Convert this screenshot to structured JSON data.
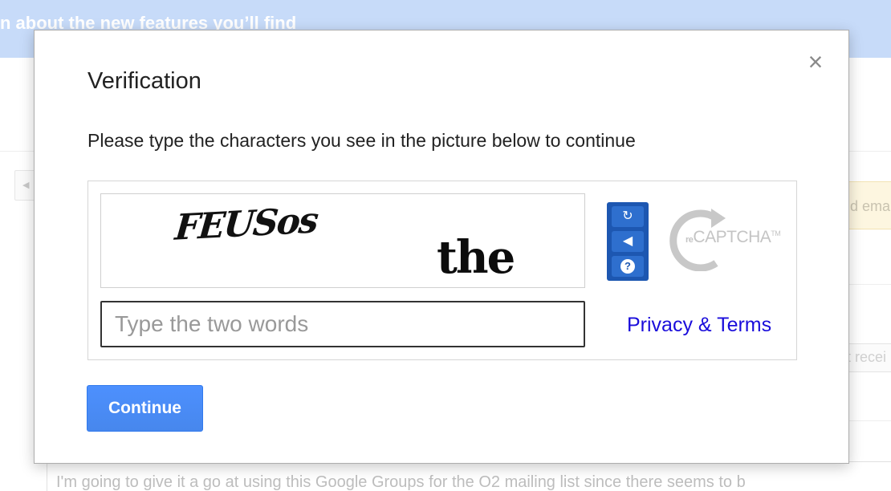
{
  "background": {
    "banner_text": "n about the new features you’ll find",
    "left_arrow_icon": "chevron-left-icon",
    "yellow_notice_text": "d ema",
    "receive_text": "t recei",
    "footer_text": "I'm going to give it a go at using this Google Groups for the O2 mailing list since there seems to b"
  },
  "dialog": {
    "title": "Verification",
    "close_symbol": "×",
    "instruction": "Please type the characters you see in the picture below to continue",
    "captcha": {
      "word1": "FEUSos",
      "word2": "the",
      "reload_symbol": "↻",
      "audio_symbol": "◀",
      "help_symbol": "?",
      "logo_prefix": "re",
      "logo_main": "CAPTCHA",
      "logo_tm": "TM"
    },
    "input_placeholder": "Type the two words",
    "input_value": "",
    "privacy_link": "Privacy & Terms",
    "continue_label": "Continue"
  },
  "colors": {
    "banner": "#c7dbf9",
    "captcha_controls": "#1d57b1",
    "link": "#1a0ddb",
    "primary_button": "#4d90fe"
  }
}
